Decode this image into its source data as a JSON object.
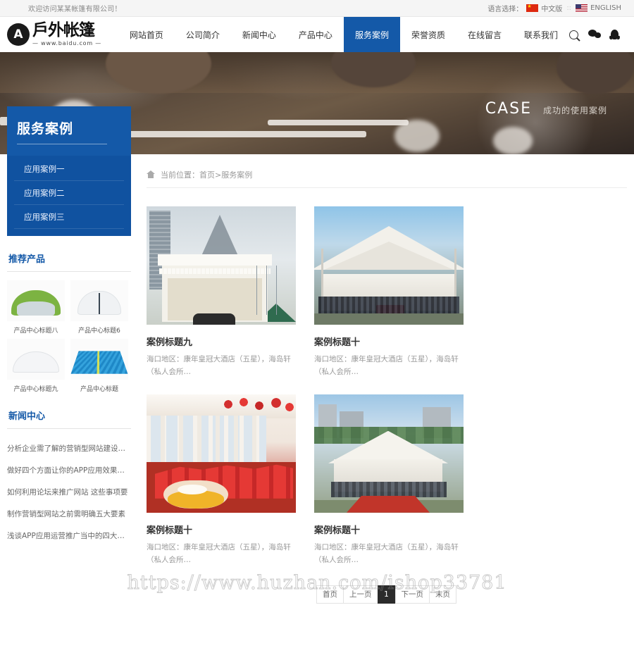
{
  "topbar": {
    "welcome": "欢迎访问某某帐篷有限公司！",
    "lang_label": "语言选择：",
    "lang_cn": "中文版",
    "lang_en": "ENGLISH",
    "separator": "::"
  },
  "logo": {
    "badge": "A",
    "name": "戶外帐篷",
    "url": "— www.baidu.com —"
  },
  "nav": {
    "items": [
      {
        "label": "网站首页",
        "active": false
      },
      {
        "label": "公司简介",
        "active": false
      },
      {
        "label": "新闻中心",
        "active": false
      },
      {
        "label": "产品中心",
        "active": false
      },
      {
        "label": "服务案例",
        "active": true
      },
      {
        "label": "荣誉资质",
        "active": false
      },
      {
        "label": "在线留言",
        "active": false
      },
      {
        "label": "联系我们",
        "active": false
      }
    ],
    "icons": [
      "search-icon",
      "wechat-icon",
      "qq-icon"
    ]
  },
  "banner": {
    "title_en": "CASE",
    "title_cn": "成功的使用案例"
  },
  "sidebar": {
    "panel_title": "服务案例",
    "menu": [
      {
        "label": "应用案例一"
      },
      {
        "label": "应用案例二"
      },
      {
        "label": "应用案例三"
      }
    ],
    "products_title": "推荐产品",
    "products": [
      {
        "caption": "产品中心标题八"
      },
      {
        "caption": "产品中心标题6"
      },
      {
        "caption": "产品中心标题九"
      },
      {
        "caption": "产品中心标题"
      }
    ],
    "news_title": "新闻中心",
    "news": [
      "分析企业需了解的营销型网站建设五部",
      "做好四个方面让你的APP应用效果更佳",
      "如何利用论坛来推广网站 这些事项要",
      "制作营销型网站之前需明确五大要素",
      "浅谈APP应用运营推广当中的四大诀窍"
    ]
  },
  "breadcrumb": {
    "text": "当前位置：首页>服务案例"
  },
  "cases": [
    {
      "title": "案例标题九",
      "desc": "海口地区：康年皇冠大酒店（五星），海岛轩（私人会所…"
    },
    {
      "title": "案例标题十",
      "desc": "海口地区：康年皇冠大酒店（五星），海岛轩（私人会所…"
    },
    {
      "title": "案例标题十",
      "desc": "海口地区：康年皇冠大酒店（五星），海岛轩（私人会所…"
    },
    {
      "title": "案例标题十",
      "desc": "海口地区：康年皇冠大酒店（五星），海岛轩（私人会所…"
    }
  ],
  "pagination": {
    "first": "首页",
    "prev": "上一页",
    "current": "1",
    "next": "下一页",
    "last": "末页"
  },
  "watermark": "https://www.huzhan.com/ishop33781",
  "colors": {
    "brand_blue": "#1459a8",
    "menu_blue": "#1052a0",
    "active_page": "#2b2b2b"
  }
}
